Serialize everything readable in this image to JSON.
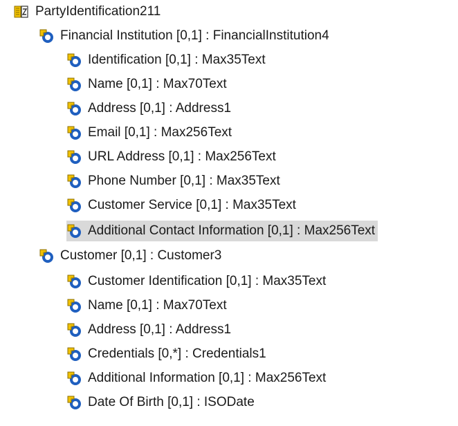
{
  "root": {
    "label": "PartyIdentification211",
    "icon": "schema-type-icon"
  },
  "groups": [
    {
      "label": "Financial Institution [0,1] : FinancialInstitution4",
      "icon": "element-icon",
      "children": [
        {
          "label": "Identification [0,1] : Max35Text",
          "icon": "element-icon"
        },
        {
          "label": "Name [0,1] : Max70Text",
          "icon": "element-icon"
        },
        {
          "label": "Address [0,1] : Address1",
          "icon": "element-icon"
        },
        {
          "label": "Email [0,1] : Max256Text",
          "icon": "element-icon"
        },
        {
          "label": "URL Address [0,1] : Max256Text",
          "icon": "element-icon"
        },
        {
          "label": "Phone Number [0,1] : Max35Text",
          "icon": "element-icon"
        },
        {
          "label": "Customer Service [0,1] : Max35Text",
          "icon": "element-icon"
        },
        {
          "label": "Additional Contact Information [0,1] : Max256Text",
          "icon": "element-icon",
          "selected": true
        }
      ]
    },
    {
      "label": "Customer [0,1] : Customer3",
      "icon": "element-icon",
      "children": [
        {
          "label": "Customer Identification [0,1] : Max35Text",
          "icon": "element-icon"
        },
        {
          "label": "Name [0,1] : Max70Text",
          "icon": "element-icon"
        },
        {
          "label": "Address [0,1] : Address1",
          "icon": "element-icon"
        },
        {
          "label": "Credentials [0,*] : Credentials1",
          "icon": "element-icon"
        },
        {
          "label": "Additional Information [0,1] : Max256Text",
          "icon": "element-icon"
        },
        {
          "label": "Date Of Birth [0,1] : ISODate",
          "icon": "element-icon"
        }
      ]
    }
  ],
  "colors": {
    "selection": "#d9d9d9",
    "icon_blue": "#1f5fbf",
    "icon_yellow": "#f2c200"
  }
}
